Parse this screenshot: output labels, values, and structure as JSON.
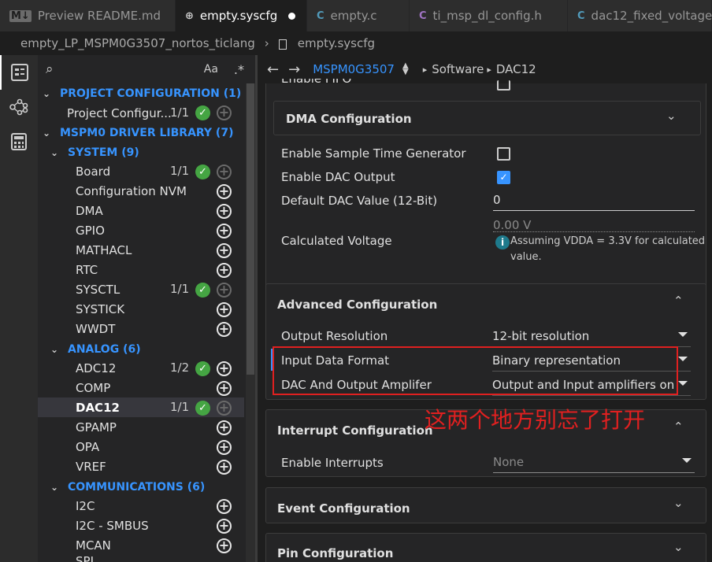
{
  "tabs": [
    {
      "icon": "M↓",
      "label": "Preview README.md"
    },
    {
      "icon": "globe",
      "label": "empty.syscfg",
      "modified": true
    },
    {
      "icon": "C",
      "label": "empty.c"
    },
    {
      "icon": "C",
      "label": "ti_msp_dl_config.h"
    },
    {
      "icon": "C",
      "label": "dac12_fixed_voltage"
    }
  ],
  "breadcrumb": {
    "project": "empty_LP_MSPM0G3507_nortos_ticlang",
    "file": "empty.syscfg"
  },
  "sidebar": {
    "search_icon": "search-icon",
    "case_label": "Aa",
    "groups": [
      {
        "label": "PROJECT CONFIGURATION (1)"
      },
      {
        "label": "MSPM0 DRIVER LIBRARY (7)"
      }
    ],
    "project_item": {
      "label": "Project Configur...",
      "count": "1/1"
    },
    "system": {
      "label": "SYSTEM (9)",
      "items": [
        {
          "label": "Board",
          "count": "1/1"
        },
        {
          "label": "Configuration NVM"
        },
        {
          "label": "DMA"
        },
        {
          "label": "GPIO"
        },
        {
          "label": "MATHACL"
        },
        {
          "label": "RTC"
        },
        {
          "label": "SYSCTL",
          "count": "1/1"
        },
        {
          "label": "SYSTICK"
        },
        {
          "label": "WWDT"
        }
      ]
    },
    "analog": {
      "label": "ANALOG (6)",
      "items": [
        {
          "label": "ADC12",
          "count": "1/2"
        },
        {
          "label": "COMP"
        },
        {
          "label": "DAC12",
          "count": "1/1"
        },
        {
          "label": "GPAMP"
        },
        {
          "label": "OPA"
        },
        {
          "label": "VREF"
        }
      ]
    },
    "comms": {
      "label": "COMMUNICATIONS (6)",
      "items": [
        {
          "label": "I2C"
        },
        {
          "label": "I2C - SMBUS"
        },
        {
          "label": "MCAN"
        },
        {
          "label": "SPI"
        }
      ]
    }
  },
  "nav": {
    "device": "MSPM0G3507",
    "crumbs": [
      "Software",
      "DAC12"
    ]
  },
  "main": {
    "fifo_label": "Enable FIFO",
    "dma_title": "DMA Configuration",
    "sample_gen_label": "Enable Sample Time Generator",
    "dac_output_label": "Enable DAC Output",
    "default_value_label": "Default DAC Value (12-Bit)",
    "default_value": "0",
    "calc_label": "Calculated Voltage",
    "calc_value": "0.00 V",
    "calc_note": "Assuming VDDA = 3.3V for calculated value.",
    "advanced_title": "Advanced Configuration",
    "output_res_label": "Output Resolution",
    "output_res_value": "12-bit resolution",
    "input_format_label": "Input Data Format",
    "input_format_value": "Binary representation",
    "amp_label": "DAC And Output Amplifer",
    "amp_value": "Output and Input amplifiers on",
    "annotation": "这两个地方别忘了打开",
    "interrupt_title": "Interrupt Configuration",
    "interrupts_label": "Enable Interrupts",
    "interrupts_value": "None",
    "event_title": "Event Configuration",
    "pin_title": "Pin Configuration"
  },
  "colors": {
    "accent": "#3794ff",
    "check": "#45a543",
    "annotation": "#e02020"
  }
}
